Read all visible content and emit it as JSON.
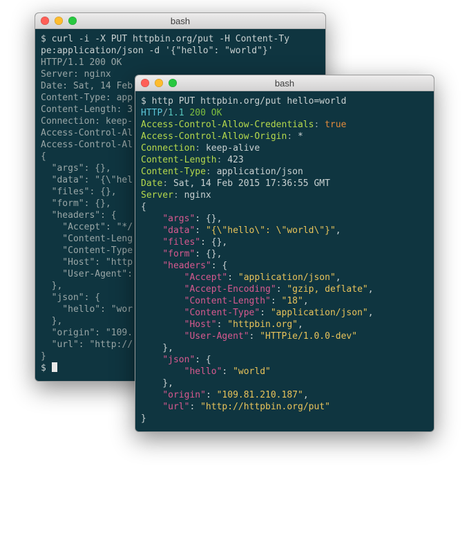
{
  "window1": {
    "title": "bash",
    "lines": [
      [
        [
          "p-prompt",
          "$ curl -i -X PUT httpbin.org/put -H Content-Ty"
        ]
      ],
      [
        [
          "p-prompt",
          "pe:application/json -d '{\"hello\": \"world\"}'"
        ]
      ],
      [
        [
          "p-dim",
          "HTTP/1.1 200 OK"
        ]
      ],
      [
        [
          "p-dim",
          "Server: nginx"
        ]
      ],
      [
        [
          "p-dim",
          "Date: Sat, 14 Feb"
        ]
      ],
      [
        [
          "p-dim",
          "Content-Type: app"
        ]
      ],
      [
        [
          "p-dim",
          "Content-Length: 3"
        ]
      ],
      [
        [
          "p-dim",
          "Connection: keep-"
        ]
      ],
      [
        [
          "p-dim",
          "Access-Control-Al"
        ]
      ],
      [
        [
          "p-dim",
          "Access-Control-Al"
        ]
      ],
      [
        [
          "p-dim",
          ""
        ]
      ],
      [
        [
          "p-dim",
          "{"
        ]
      ],
      [
        [
          "p-dim",
          "  \"args\": {},"
        ]
      ],
      [
        [
          "p-dim",
          "  \"data\": \"{\\\"hel"
        ]
      ],
      [
        [
          "p-dim",
          "  \"files\": {},"
        ]
      ],
      [
        [
          "p-dim",
          "  \"form\": {},"
        ]
      ],
      [
        [
          "p-dim",
          "  \"headers\": {"
        ]
      ],
      [
        [
          "p-dim",
          "    \"Accept\": \"*/"
        ]
      ],
      [
        [
          "p-dim",
          "    \"Content-Leng"
        ]
      ],
      [
        [
          "p-dim",
          "    \"Content-Type"
        ]
      ],
      [
        [
          "p-dim",
          "    \"Host\": \"http"
        ]
      ],
      [
        [
          "p-dim",
          "    \"User-Agent\":"
        ]
      ],
      [
        [
          "p-dim",
          "  },"
        ]
      ],
      [
        [
          "p-dim",
          "  \"json\": {"
        ]
      ],
      [
        [
          "p-dim",
          "    \"hello\": \"wor"
        ]
      ],
      [
        [
          "p-dim",
          "  },"
        ]
      ],
      [
        [
          "p-dim",
          "  \"origin\": \"109."
        ]
      ],
      [
        [
          "p-dim",
          "  \"url\": \"http://"
        ]
      ],
      [
        [
          "p-dim",
          "}"
        ]
      ]
    ],
    "prompt": "$ "
  },
  "window2": {
    "title": "bash",
    "lines": [
      [
        [
          "p-prompt",
          "$ http PUT httpbin.org/put hello=world"
        ]
      ],
      [
        [
          "p-cyan",
          "HTTP"
        ],
        [
          "p-dim",
          "/"
        ],
        [
          "p-teal",
          "1.1 "
        ],
        [
          "p-green",
          "200 OK"
        ]
      ],
      [
        [
          "p-lime",
          "Access-Control-Allow-Credentials"
        ],
        [
          "p-dim",
          ": "
        ],
        [
          "p-orange",
          "true"
        ]
      ],
      [
        [
          "p-lime",
          "Access-Control-Allow-Origin"
        ],
        [
          "p-dim",
          ": "
        ],
        [
          "p-prompt",
          "*"
        ]
      ],
      [
        [
          "p-lime",
          "Connection"
        ],
        [
          "p-dim",
          ": "
        ],
        [
          "p-prompt",
          "keep-alive"
        ]
      ],
      [
        [
          "p-lime",
          "Content-Length"
        ],
        [
          "p-dim",
          ": "
        ],
        [
          "p-prompt",
          "423"
        ]
      ],
      [
        [
          "p-lime",
          "Content-Type"
        ],
        [
          "p-dim",
          ": "
        ],
        [
          "p-prompt",
          "application/json"
        ]
      ],
      [
        [
          "p-lime",
          "Date"
        ],
        [
          "p-dim",
          ": "
        ],
        [
          "p-prompt",
          "Sat, 14 Feb 2015 17:36:55 GMT"
        ]
      ],
      [
        [
          "p-lime",
          "Server"
        ],
        [
          "p-dim",
          ": "
        ],
        [
          "p-prompt",
          "nginx"
        ]
      ],
      [
        [
          "p-prompt",
          ""
        ]
      ],
      [
        [
          "p-prompt",
          "{"
        ]
      ],
      [
        [
          "p-prompt",
          "    "
        ],
        [
          "p-pink",
          "\"args\""
        ],
        [
          "p-prompt",
          ": {},"
        ]
      ],
      [
        [
          "p-prompt",
          "    "
        ],
        [
          "p-pink",
          "\"data\""
        ],
        [
          "p-prompt",
          ": "
        ],
        [
          "p-yellow",
          "\"{\\\"hello\\\": \\\"world\\\"}\""
        ],
        [
          "p-prompt",
          ","
        ]
      ],
      [
        [
          "p-prompt",
          "    "
        ],
        [
          "p-pink",
          "\"files\""
        ],
        [
          "p-prompt",
          ": {},"
        ]
      ],
      [
        [
          "p-prompt",
          "    "
        ],
        [
          "p-pink",
          "\"form\""
        ],
        [
          "p-prompt",
          ": {},"
        ]
      ],
      [
        [
          "p-prompt",
          "    "
        ],
        [
          "p-pink",
          "\"headers\""
        ],
        [
          "p-prompt",
          ": {"
        ]
      ],
      [
        [
          "p-prompt",
          "        "
        ],
        [
          "p-pink",
          "\"Accept\""
        ],
        [
          "p-prompt",
          ": "
        ],
        [
          "p-yellow",
          "\"application/json\""
        ],
        [
          "p-prompt",
          ","
        ]
      ],
      [
        [
          "p-prompt",
          "        "
        ],
        [
          "p-pink",
          "\"Accept-Encoding\""
        ],
        [
          "p-prompt",
          ": "
        ],
        [
          "p-yellow",
          "\"gzip, deflate\""
        ],
        [
          "p-prompt",
          ","
        ]
      ],
      [
        [
          "p-prompt",
          "        "
        ],
        [
          "p-pink",
          "\"Content-Length\""
        ],
        [
          "p-prompt",
          ": "
        ],
        [
          "p-yellow",
          "\"18\""
        ],
        [
          "p-prompt",
          ","
        ]
      ],
      [
        [
          "p-prompt",
          "        "
        ],
        [
          "p-pink",
          "\"Content-Type\""
        ],
        [
          "p-prompt",
          ": "
        ],
        [
          "p-yellow",
          "\"application/json\""
        ],
        [
          "p-prompt",
          ","
        ]
      ],
      [
        [
          "p-prompt",
          "        "
        ],
        [
          "p-pink",
          "\"Host\""
        ],
        [
          "p-prompt",
          ": "
        ],
        [
          "p-yellow",
          "\"httpbin.org\""
        ],
        [
          "p-prompt",
          ","
        ]
      ],
      [
        [
          "p-prompt",
          "        "
        ],
        [
          "p-pink",
          "\"User-Agent\""
        ],
        [
          "p-prompt",
          ": "
        ],
        [
          "p-yellow",
          "\"HTTPie/1.0.0-dev\""
        ]
      ],
      [
        [
          "p-prompt",
          "    },"
        ]
      ],
      [
        [
          "p-prompt",
          "    "
        ],
        [
          "p-pink",
          "\"json\""
        ],
        [
          "p-prompt",
          ": {"
        ]
      ],
      [
        [
          "p-prompt",
          "        "
        ],
        [
          "p-pink",
          "\"hello\""
        ],
        [
          "p-prompt",
          ": "
        ],
        [
          "p-yellow",
          "\"world\""
        ]
      ],
      [
        [
          "p-prompt",
          "    },"
        ]
      ],
      [
        [
          "p-prompt",
          "    "
        ],
        [
          "p-pink",
          "\"origin\""
        ],
        [
          "p-prompt",
          ": "
        ],
        [
          "p-yellow",
          "\"109.81.210.187\""
        ],
        [
          "p-prompt",
          ","
        ]
      ],
      [
        [
          "p-prompt",
          "    "
        ],
        [
          "p-pink",
          "\"url\""
        ],
        [
          "p-prompt",
          ": "
        ],
        [
          "p-yellow",
          "\"http://httpbin.org/put\""
        ]
      ],
      [
        [
          "p-prompt",
          "}"
        ]
      ]
    ]
  }
}
